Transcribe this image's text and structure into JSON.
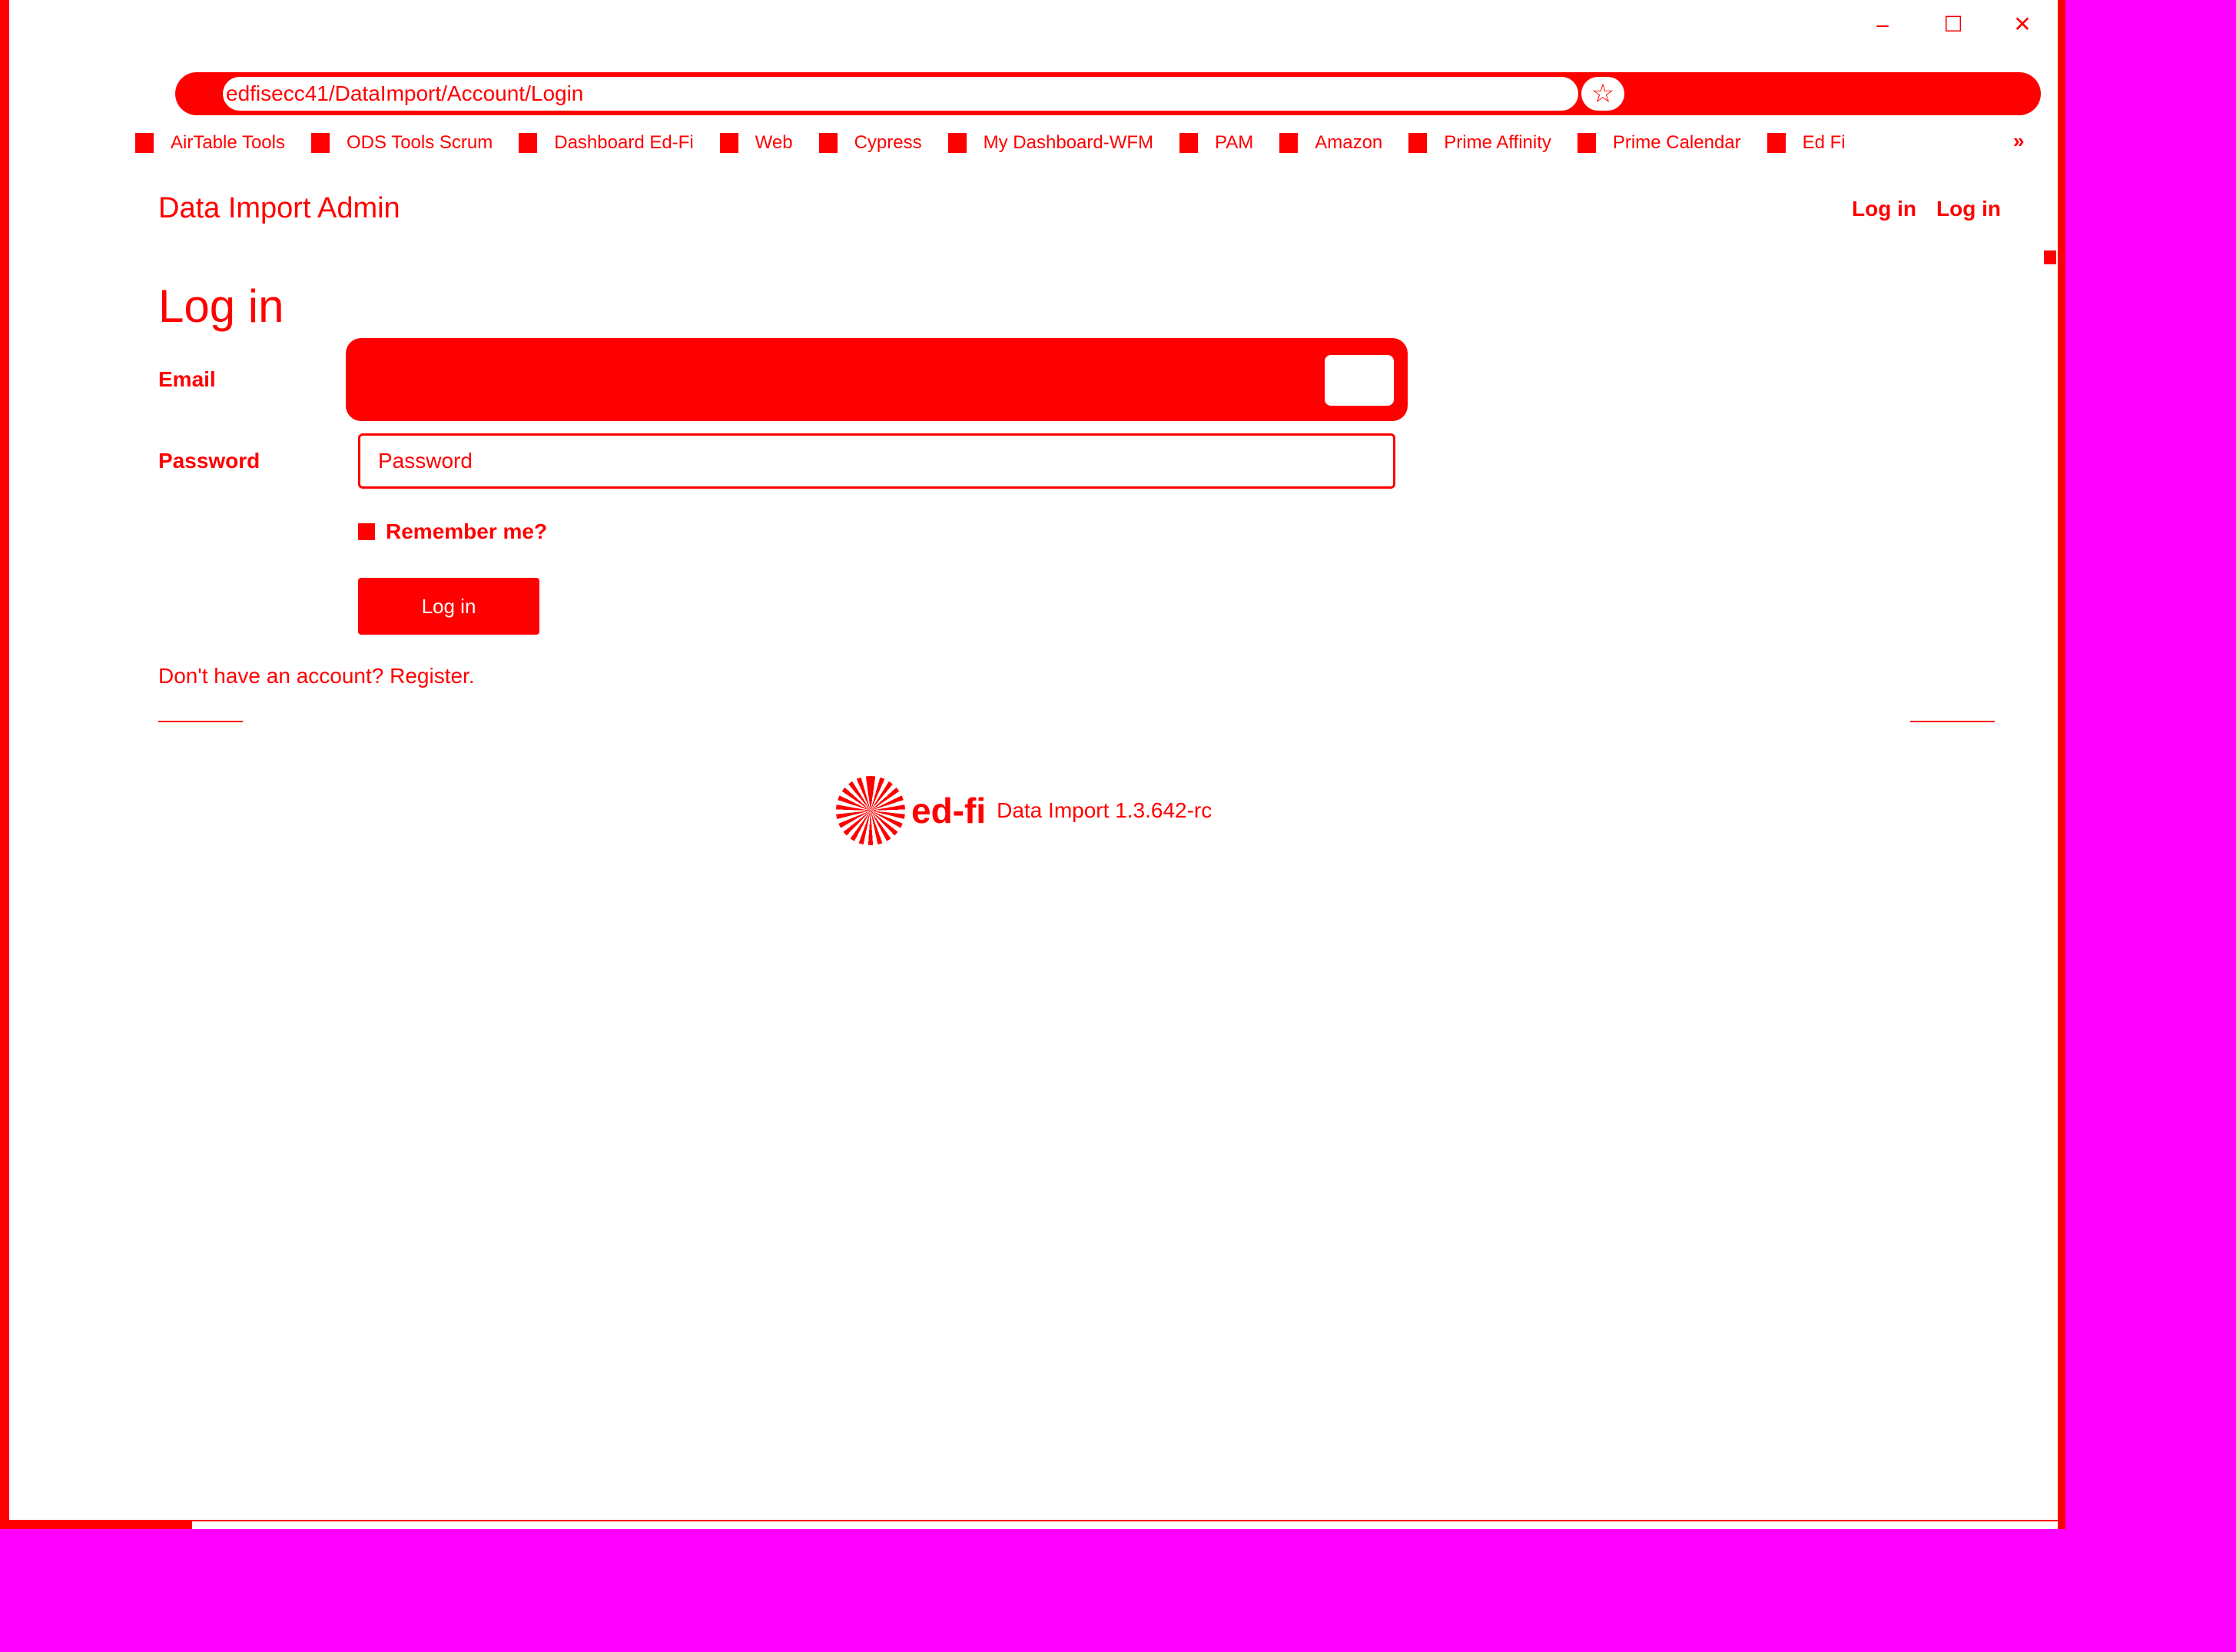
{
  "window": {
    "minimize_glyph": "–",
    "maximize_glyph": "☐",
    "close_glyph": "✕"
  },
  "address_bar": {
    "url": "edfisecc41/DataImport/Account/Login",
    "star_glyph": "☆"
  },
  "bookmarks": [
    {
      "label": "AirTable Tools"
    },
    {
      "label": "ODS Tools Scrum"
    },
    {
      "label": "Dashboard Ed-Fi"
    },
    {
      "label": "Web"
    },
    {
      "label": "Cypress"
    },
    {
      "label": "My Dashboard-WFM"
    },
    {
      "label": "PAM"
    },
    {
      "label": "Amazon"
    },
    {
      "label": "Prime Affinity"
    },
    {
      "label": "Prime Calendar"
    },
    {
      "label": "Ed Fi"
    }
  ],
  "bookmarks_more": "»",
  "header": {
    "brand": "Data Import Admin",
    "login_link_1": "Log in",
    "login_link_2": "Log in"
  },
  "form": {
    "title": "Log in",
    "email_label": "Email",
    "password_label": "Password",
    "password_placeholder": "Password",
    "remember_label": "Remember me?",
    "submit_label": "Log in",
    "register_text": "Don't have an account? Register."
  },
  "footer": {
    "logo_text": "ed-fi",
    "version": "Data Import 1.3.642-rc"
  },
  "colors": {
    "accent": "#ff0000",
    "background": "#ff00ff",
    "page": "#ffffff"
  }
}
